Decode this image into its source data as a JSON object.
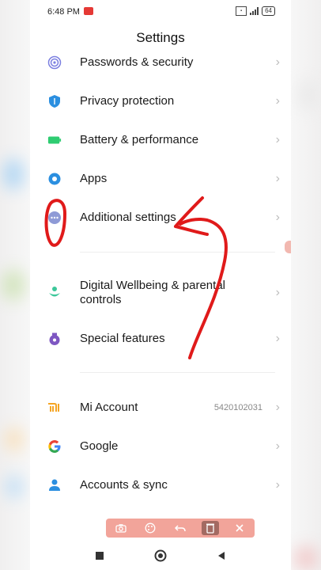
{
  "status_bar": {
    "time": "6:48 PM",
    "battery": "64"
  },
  "page": {
    "title": "Settings"
  },
  "rows": [
    {
      "label": "Passwords & security"
    },
    {
      "label": "Privacy protection"
    },
    {
      "label": "Battery & performance"
    },
    {
      "label": "Apps"
    },
    {
      "label": "Additional settings"
    },
    {
      "label": "Digital Wellbeing & parental controls"
    },
    {
      "label": "Special features"
    },
    {
      "label": "Mi Account",
      "value": "5420102031"
    },
    {
      "label": "Google"
    },
    {
      "label": "Accounts & sync"
    }
  ],
  "icons": {
    "passwords": "fingerprint-icon",
    "privacy": "shield-icon",
    "battery": "battery-icon",
    "apps": "gear-icon",
    "additional": "dots-icon",
    "wellbeing": "wellbeing-icon",
    "special": "special-features-icon",
    "mi": "mi-logo-icon",
    "google": "google-logo-icon",
    "accounts": "person-icon"
  },
  "toolbar": {
    "buttons": [
      "camera-icon",
      "palette-icon",
      "undo-icon",
      "trash-icon",
      "close-icon"
    ]
  },
  "colors": {
    "annotation_red": "#e01a1a",
    "accent_blue": "#2b8fe0",
    "toolbar_bg": "#f2a49a"
  }
}
